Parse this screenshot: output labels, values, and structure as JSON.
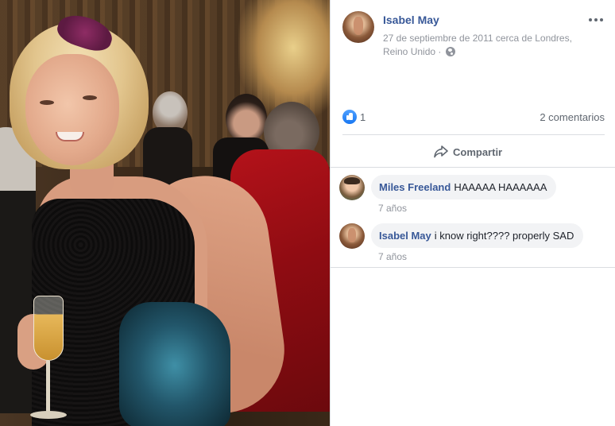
{
  "post": {
    "author": "Isabel May",
    "meta": "27 de septiembre de 2011 cerca de Londres, Reino Unido ·",
    "privacy_icon": "globe-icon",
    "options_icon": "more-icon"
  },
  "stats": {
    "like_count": "1",
    "comments_label": "2 comentarios"
  },
  "actions": {
    "share_label": "Compartir"
  },
  "comments": [
    {
      "name": "Miles Freeland",
      "text": "HAAAAA HAAAAAA",
      "time": "7 años"
    },
    {
      "name": "Isabel May",
      "text": "i know right???? properly SAD",
      "time": "7 años"
    }
  ],
  "colors": {
    "link": "#385898",
    "meta": "#90949c",
    "like": "#1877f2",
    "bubble": "#f2f3f5"
  }
}
